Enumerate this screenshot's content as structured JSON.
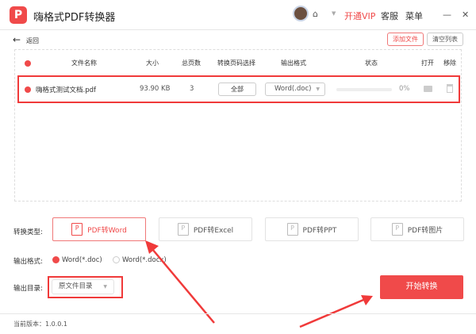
{
  "app": {
    "title": "嗨格式PDF转换器",
    "logo": "P"
  },
  "header": {
    "vip": "开通VIP",
    "service": "客服",
    "menu": "菜单",
    "minimize": "—",
    "close": "✕"
  },
  "toolbar": {
    "back": "返回",
    "add_file": "添加文件",
    "clear_list": "清空列表"
  },
  "table": {
    "columns": [
      "文件名称",
      "大小",
      "总页数",
      "转换页码选择",
      "输出格式",
      "状态",
      "打开",
      "移除"
    ],
    "rows": [
      {
        "name": "嗨格式测试文档.pdf",
        "size": "93.90 KB",
        "pages": "3",
        "page_select": "全部",
        "format": "Word(.doc)",
        "progress": 0,
        "status": "0%"
      }
    ]
  },
  "options": {
    "type_label": "转换类型:",
    "types": [
      {
        "label": "PDF转Word",
        "active": true
      },
      {
        "label": "PDF转Excel"
      },
      {
        "label": "PDF转PPT"
      },
      {
        "label": "PDF转图片"
      }
    ],
    "format_label": "输出格式:",
    "formats": [
      {
        "label": "Word(*.doc)",
        "checked": true
      },
      {
        "label": "Word(*.docx)",
        "checked": false
      }
    ],
    "dir_label": "输出目录:",
    "dir_value": "原文件目录",
    "start": "开始转换"
  },
  "footer": {
    "version": "当前版本：1.0.0.1"
  },
  "colors": {
    "accent": "#f04a4a"
  }
}
